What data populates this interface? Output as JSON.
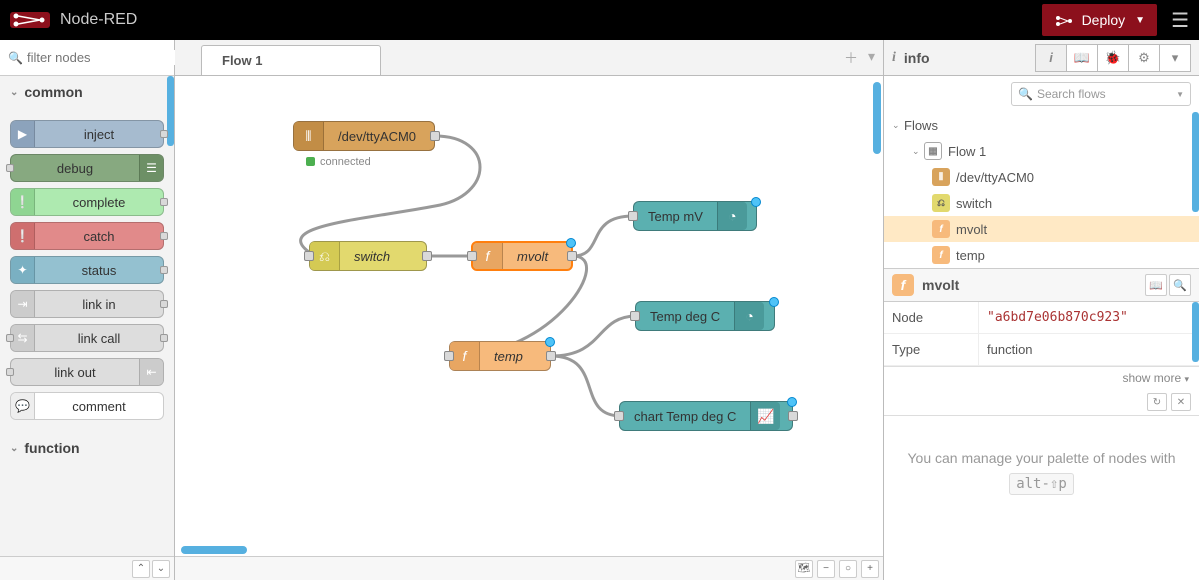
{
  "header": {
    "brand": "Node-RED",
    "deploy": "Deploy"
  },
  "palette": {
    "filter_placeholder": "filter nodes",
    "categories": {
      "common": "common",
      "function": "function"
    },
    "nodes": {
      "inject": "inject",
      "debug": "debug",
      "complete": "complete",
      "catch": "catch",
      "status": "status",
      "link_in": "link in",
      "link_call": "link call",
      "link_out": "link out",
      "comment": "comment"
    }
  },
  "workspace": {
    "tab": "Flow 1"
  },
  "flow_nodes": {
    "serial": {
      "label": "/dev/ttyACM0",
      "status": "connected"
    },
    "switch": {
      "label": "switch"
    },
    "mvolt": {
      "label": "mvolt"
    },
    "temp": {
      "label": "temp"
    },
    "gauge_mv": {
      "label": "Temp mV"
    },
    "gauge_c": {
      "label": "Temp deg C"
    },
    "chart_c": {
      "label": "chart Temp deg C"
    }
  },
  "sidebar": {
    "title": "info",
    "search_placeholder": "Search flows",
    "tree": {
      "flows": "Flows",
      "flow1": "Flow 1",
      "serial": "/dev/ttyACM0",
      "switch": "switch",
      "mvolt": "mvolt",
      "temp": "temp"
    },
    "detail": {
      "title": "mvolt",
      "node_key": "Node",
      "node_val": "\"a6bd7e06b870c923\"",
      "type_key": "Type",
      "type_val": "function",
      "show_more": "show more"
    },
    "tip_pre": "You can manage your palette of nodes with ",
    "tip_code": "alt-⇧p"
  }
}
